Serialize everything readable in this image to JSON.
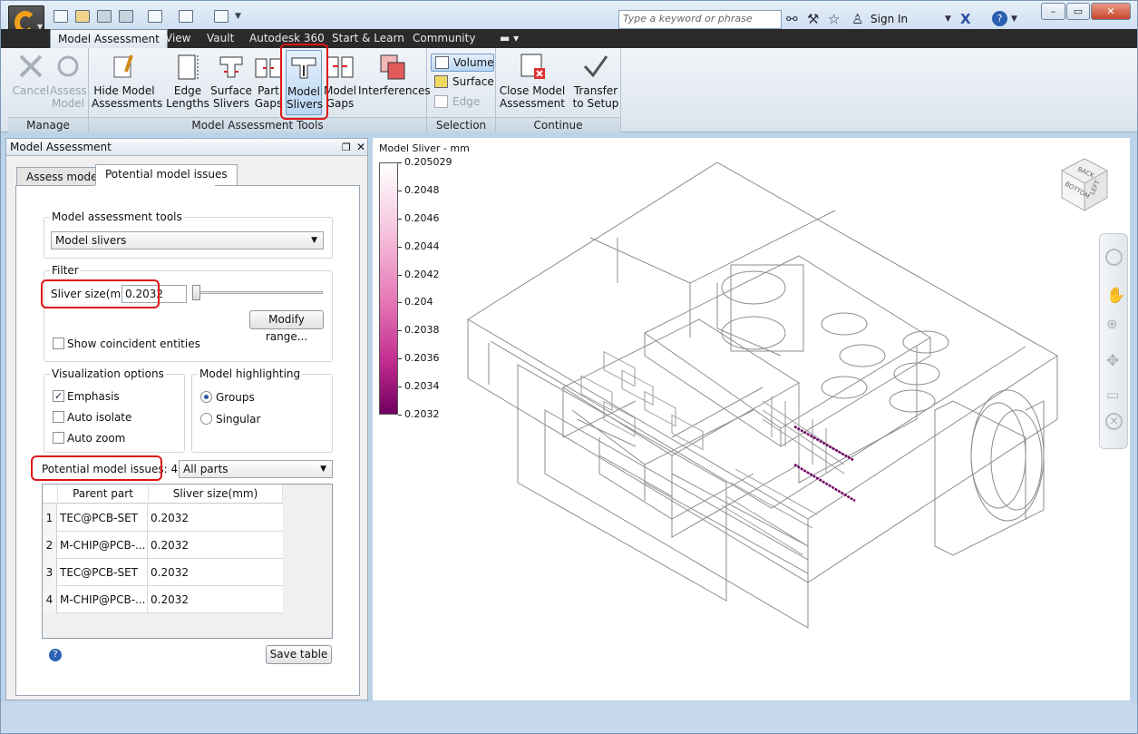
{
  "app": {
    "search_placeholder": "Type a keyword or phrase",
    "sign_in": "Sign In"
  },
  "ribbon": {
    "tabs": [
      "Model Assessment",
      "View",
      "Vault",
      "Autodesk 360",
      "Start & Learn",
      "Community"
    ],
    "groups": {
      "manage": "Manage",
      "tools": "Model Assessment Tools",
      "selection": "Selection",
      "continue": "Continue"
    },
    "buttons": {
      "cancel": "Cancel",
      "assess_model": [
        "Assess",
        "Model"
      ],
      "hide_assessments": [
        "Hide Model",
        "Assessments"
      ],
      "edge_lengths": [
        "Edge",
        "Lengths"
      ],
      "surface_slivers": [
        "Surface",
        "Slivers"
      ],
      "part_gaps": [
        "Part",
        "Gaps"
      ],
      "model_slivers": [
        "Model",
        "Slivers"
      ],
      "model_gaps": [
        "Model",
        "Gaps"
      ],
      "interferences": "Interferences",
      "volume": "Volume",
      "surface": "Surface",
      "edge": "Edge",
      "close_assessment": [
        "Close Model",
        "Assessment"
      ],
      "transfer_setup": [
        "Transfer",
        "to Setup"
      ]
    }
  },
  "panel": {
    "title": "Model Assessment",
    "tabs": [
      "Assess model",
      "Potential model issues"
    ],
    "tools_legend": "Model assessment tools",
    "tools_value": "Model slivers",
    "filter_legend": "Filter",
    "sliver_label": "Sliver size(mm)",
    "sliver_value": "0.2032",
    "modify_range": "Modify range...",
    "show_coincident": "Show coincident entities",
    "vis_legend": "Visualization options",
    "emphasis": "Emphasis",
    "auto_isolate": "Auto isolate",
    "auto_zoom": "Auto zoom",
    "highlight_legend": "Model highlighting",
    "groups": "Groups",
    "singular": "Singular",
    "issues_label": "Potential model issues: 4",
    "parts_filter": "All parts",
    "table": {
      "headers": [
        "Parent part",
        "Sliver size(mm)"
      ],
      "rows": [
        {
          "n": "1",
          "part": "TEC@PCB-SET",
          "size": "0.2032"
        },
        {
          "n": "2",
          "part": "M-CHIP@PCB-...",
          "size": "0.2032"
        },
        {
          "n": "3",
          "part": "TEC@PCB-SET",
          "size": "0.2032"
        },
        {
          "n": "4",
          "part": "M-CHIP@PCB-...",
          "size": "0.2032"
        }
      ]
    },
    "save_table": "Save table"
  },
  "viewport": {
    "legend_title": "Model Sliver - mm",
    "legend_values": [
      "0.205029",
      "0.2048",
      "0.2046",
      "0.2044",
      "0.2042",
      "0.204",
      "0.2038",
      "0.2036",
      "0.2034",
      "0.2032"
    ],
    "viewcube": {
      "back": "BACK",
      "bottom": "BOTTOM",
      "left": "LEFT"
    }
  },
  "colors": {
    "accent": "#e01515",
    "selected": "#b9d6f3",
    "sliver": "#6f0060"
  }
}
